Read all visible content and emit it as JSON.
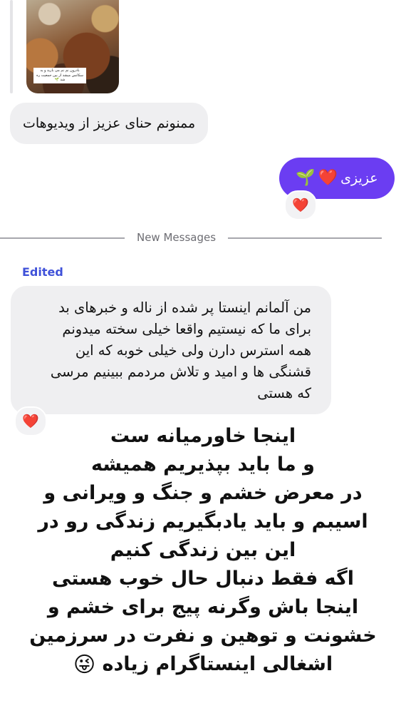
{
  "shared_media": {
    "caption": "بادرون نم نم می بارید و یه سکانس میشد از بین جمعیت ره شد 🌱"
  },
  "messages": {
    "incoming_1": {
      "text": "ممنونم حنای عزیز از ویدیوهات"
    },
    "outgoing_1": {
      "text": "عزیزی",
      "emoji_1": "❤️",
      "emoji_2": "🌱",
      "reaction": "❤️"
    },
    "divider": {
      "label": "New Messages"
    },
    "edited_label": "Edited",
    "incoming_2": {
      "lines": [
        "من آلمانم اینستا پر شده از ناله و خبرهای بد",
        "برای ما که نیستیم واقعا خیلی سخته  میدونم",
        "همه استرس دارن ولی خیلی خوبه که این",
        "قشنگی ها و امید و تلاش مردمم ببینیم مرسی",
        "که هستی"
      ],
      "reaction": "❤️"
    }
  },
  "overlay_text": {
    "lines": [
      "اینجا خاورمیانه ست",
      "و ما باید بپذیریم همیشه",
      "در معرض خشم و جنگ و ویرانی و",
      "اسیبم و باید یادبگیریم زندگی رو در",
      "این بین زندگی کنیم",
      "اگه فقط دنبال حال خوب هستی",
      "اینجا باش وگرنه پیج برای خشم و",
      "خشونت و توهین و نفرت در سرزمین",
      "اشغالی اینستاگرام زیاده"
    ],
    "trailing_emoji": "😜"
  },
  "colors": {
    "outgoing_bubble": "#6b3df2",
    "incoming_bubble": "#efeff1",
    "edited_label": "#3f51d9",
    "divider_text": "#6d6d73"
  }
}
